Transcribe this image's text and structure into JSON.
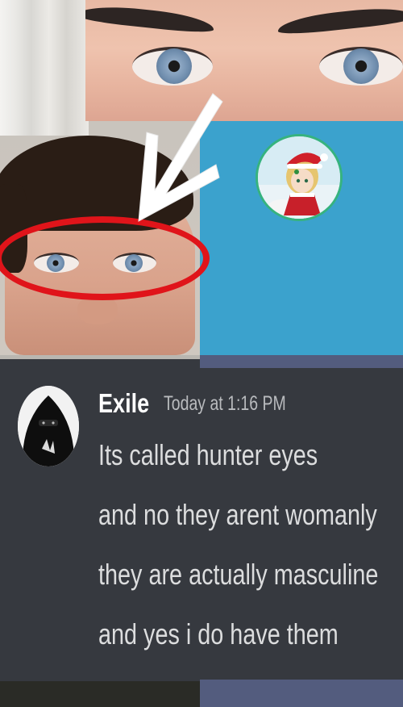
{
  "message": {
    "username": "Exile",
    "timestamp": "Today at 1:16 PM",
    "lines": [
      "Its called hunter eyes",
      "and no they arent womanly",
      "they are actually masculine",
      "and yes i do have them"
    ]
  },
  "colors": {
    "chat_background": "#36393f",
    "annotation_circle": "#e0141a",
    "blue_panel": "#3ba2cd",
    "avatar_ring": "#36b37e"
  },
  "icons": {
    "annotation": "white-arrow-icon",
    "profile_picture": "anime-santa-avatar",
    "sender_avatar": "hooded-figure-avatar"
  }
}
